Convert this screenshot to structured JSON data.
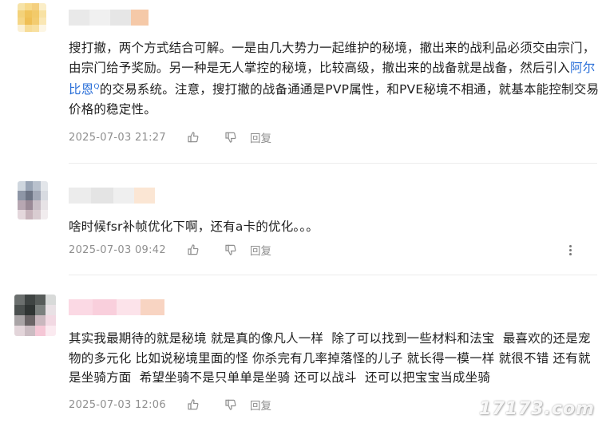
{
  "comments": [
    {
      "text_before": "搜打撤，两个方式结合可解。一是由几大势力一起维护的秘境，撤出来的战利品必须交由宗门，由宗门给予奖励。另一种是无人掌控的秘境，比较高级，撤出来的战备就是战备，然后引入",
      "link_text": "阿尔比恩",
      "link_sup": "Q",
      "text_after": "的交易系统。注意，搜打撤的战备通通是PVP属性，和PVE秘境不相通，就基本能控制交易价格的稳定性。",
      "time": "2025-07-03 21:27",
      "reply_label": "回复"
    },
    {
      "text": "啥时候fsr补帧优化下啊，还有a卡的优化。。。",
      "time": "2025-07-03 09:42",
      "reply_label": "回复"
    },
    {
      "text": "其实我最期待的就是秘境 就是真的像凡人一样  除了可以找到一些材料和法宝  最喜欢的还是宠物的多元化 比如说秘境里面的怪 你杀完有几率掉落怪的儿子 就长得一模一样 就很不错 还有就是坐骑方面  希望坐骑不是只单单是坐骑 还可以战斗  还可以把宝宝当成坐骑",
      "time": "2025-07-03 12:06",
      "reply_label": "回复"
    }
  ],
  "watermark": "17173.com",
  "icons": {
    "like": "thumbs-up-icon",
    "dislike": "thumbs-down-icon",
    "more": "more-vertical-icon"
  },
  "colors": {
    "link": "#2a6fd8",
    "meta": "#8f8f8f",
    "divider": "#ececec"
  }
}
